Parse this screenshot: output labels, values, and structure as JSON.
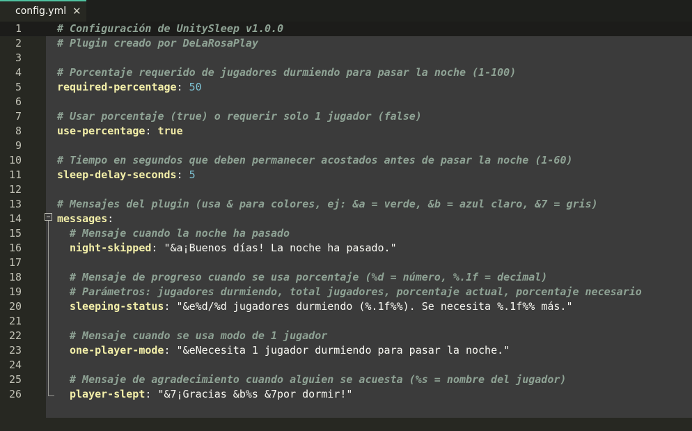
{
  "tab": {
    "filename": "config.yml",
    "close_glyph": "✕"
  },
  "lines": [
    {
      "n": "1",
      "comment": "# Configuración de UnitySleep v1.0.0"
    },
    {
      "n": "2",
      "comment": "# Plugin creado por DeLaRosaPlay"
    },
    {
      "n": "3"
    },
    {
      "n": "4",
      "comment": "# Porcentaje requerido de jugadores durmiendo para pasar la noche (1-100)"
    },
    {
      "n": "5",
      "key": "required-percentage",
      "value": "50"
    },
    {
      "n": "6"
    },
    {
      "n": "7",
      "comment": "# Usar porcentaje (true) o requerir solo 1 jugador (false)"
    },
    {
      "n": "8",
      "key": "use-percentage",
      "value": "true"
    },
    {
      "n": "9"
    },
    {
      "n": "10",
      "comment": "# Tiempo en segundos que deben permanecer acostados antes de pasar la noche (1-60)"
    },
    {
      "n": "11",
      "key": "sleep-delay-seconds",
      "value": "5"
    },
    {
      "n": "12"
    },
    {
      "n": "13",
      "comment": "# Mensajes del plugin (usa & para colores, ej: &a = verde, &b = azul claro, &7 = gris)"
    },
    {
      "n": "14",
      "key": "messages"
    },
    {
      "n": "15",
      "comment": "# Mensaje cuando la noche ha pasado"
    },
    {
      "n": "16",
      "key": "night-skipped",
      "value": "\"&a¡Buenos días! La noche ha pasado.\""
    },
    {
      "n": "17"
    },
    {
      "n": "18",
      "comment": "# Mensaje de progreso cuando se usa porcentaje (%d = número, %.1f = decimal)"
    },
    {
      "n": "19",
      "comment": "# Parámetros: jugadores durmiendo, total jugadores, porcentaje actual, porcentaje necesario"
    },
    {
      "n": "20",
      "key": "sleeping-status",
      "value": "\"&e%d/%d jugadores durmiendo (%.1f%%). Se necesita %.1f%% más.\""
    },
    {
      "n": "21"
    },
    {
      "n": "22",
      "comment": "# Mensaje cuando se usa modo de 1 jugador"
    },
    {
      "n": "23",
      "key": "one-player-mode",
      "value": "\"&eNecesita 1 jugador durmiendo para pasar la noche.\""
    },
    {
      "n": "24"
    },
    {
      "n": "25",
      "comment": "# Mensaje de agradecimiento cuando alguien se acuesta (%s = nombre del jugador)"
    },
    {
      "n": "26",
      "key": "player-slept",
      "value": "\"&7¡Gracias &b%s &7por dormir!\""
    }
  ],
  "colors": {
    "editor_bg": "#3b3b3b",
    "gutter_bg": "#272822",
    "tab_accent": "#4fc1a0",
    "comment": "#8fa395",
    "key": "#f3efa9",
    "number": "#7fc5d6"
  }
}
